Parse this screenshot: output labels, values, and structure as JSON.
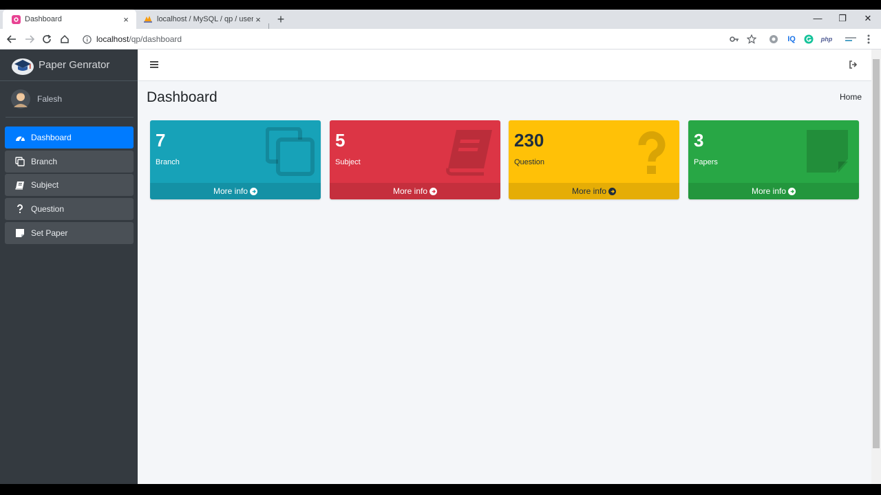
{
  "browser": {
    "tabs": [
      {
        "title": "Dashboard",
        "close": "×"
      },
      {
        "title": "localhost / MySQL / qp / user | p",
        "close": "×"
      }
    ],
    "new_tab": "+",
    "window_controls": {
      "minimize": "—",
      "restore": "❐",
      "close": "✕"
    },
    "url": {
      "host": "localhost",
      "path": "/qp/dashboard"
    },
    "extensions": [
      "IQ",
      "php"
    ]
  },
  "app": {
    "brand": "Paper Genrator",
    "user": "Falesh",
    "nav": [
      {
        "label": "Dashboard",
        "icon": "tachometer-icon",
        "active": true
      },
      {
        "label": "Branch",
        "icon": "copy-icon",
        "active": false
      },
      {
        "label": "Subject",
        "icon": "book-icon",
        "active": false
      },
      {
        "label": "Question",
        "icon": "question-icon",
        "active": false
      },
      {
        "label": "Set Paper",
        "icon": "sticky-note-icon",
        "active": false
      }
    ],
    "page_title": "Dashboard",
    "breadcrumb": "Home",
    "boxes": [
      {
        "count": "7",
        "label": "Branch",
        "footer": "More info",
        "color": "#17a2b8",
        "icon": "copy-icon"
      },
      {
        "count": "5",
        "label": "Subject",
        "footer": "More info",
        "color": "#dc3545",
        "icon": "book-icon"
      },
      {
        "count": "230",
        "label": "Question",
        "footer": "More info",
        "color": "#ffc107",
        "icon": "question-icon"
      },
      {
        "count": "3",
        "label": "Papers",
        "footer": "More info",
        "color": "#28a745",
        "icon": "sticky-note-icon"
      }
    ]
  }
}
